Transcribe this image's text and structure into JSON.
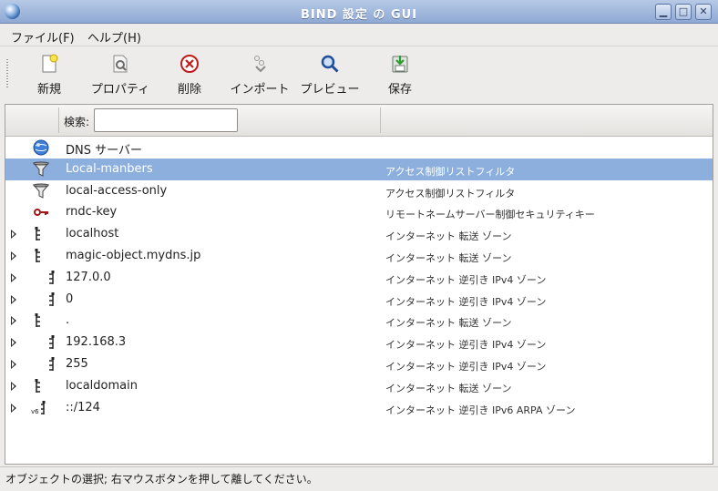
{
  "window": {
    "title": "BIND 設定 の GUI"
  },
  "menu": {
    "file": "ファイル(F)",
    "help": "ヘルプ(H)"
  },
  "toolbar": {
    "new": "新規",
    "properties": "プロパティ",
    "delete": "削除",
    "import": "インポート",
    "preview": "プレビュー",
    "save": "保存"
  },
  "search": {
    "label": "検索:",
    "value": ""
  },
  "rows": [
    {
      "name": "DNS サーバー",
      "type": "",
      "icon": "dns-server-icon",
      "expandable": false
    },
    {
      "name": "Local-manbers",
      "type": "アクセス制御リストフィルタ",
      "icon": "funnel-icon",
      "expandable": false,
      "selected": true
    },
    {
      "name": "local-access-only",
      "type": "アクセス制御リストフィルタ",
      "icon": "funnel-icon",
      "expandable": false
    },
    {
      "name": "rndc-key",
      "type": "リモートネームサーバー制御セキュリティキー",
      "icon": "key-icon",
      "expandable": false
    },
    {
      "name": "localhost",
      "type": "インターネット 転送 ゾーン",
      "icon": "forward-zone-icon",
      "expandable": true
    },
    {
      "name": "magic-object.mydns.jp",
      "type": "インターネット 転送 ゾーン",
      "icon": "forward-zone-icon",
      "expandable": true
    },
    {
      "name": "127.0.0",
      "type": "インターネット 逆引き IPv4 ゾーン",
      "icon": "reverse-zone-icon",
      "expandable": true
    },
    {
      "name": "0",
      "type": "インターネット 逆引き IPv4 ゾーン",
      "icon": "reverse-zone-icon",
      "expandable": true
    },
    {
      "name": ".",
      "type": "インターネット 転送 ゾーン",
      "icon": "forward-zone-icon",
      "expandable": true
    },
    {
      "name": "192.168.3",
      "type": "インターネット 逆引き IPv4 ゾーン",
      "icon": "reverse-zone-icon",
      "expandable": true
    },
    {
      "name": "255",
      "type": "インターネット 逆引き IPv4 ゾーン",
      "icon": "reverse-zone-icon",
      "expandable": true
    },
    {
      "name": "localdomain",
      "type": "インターネット 転送 ゾーン",
      "icon": "forward-zone-icon",
      "expandable": true
    },
    {
      "name": "::/124",
      "type": "インターネット 逆引き IPv6 ARPA ゾーン",
      "icon": "ipv6-reverse-zone-icon",
      "expandable": true
    }
  ],
  "status": {
    "text": "オブジェクトの選択; 右マウスボタンを押して離してください。"
  },
  "colors": {
    "selection": "#8cafdd",
    "titlebar": "#9fb6dc"
  }
}
